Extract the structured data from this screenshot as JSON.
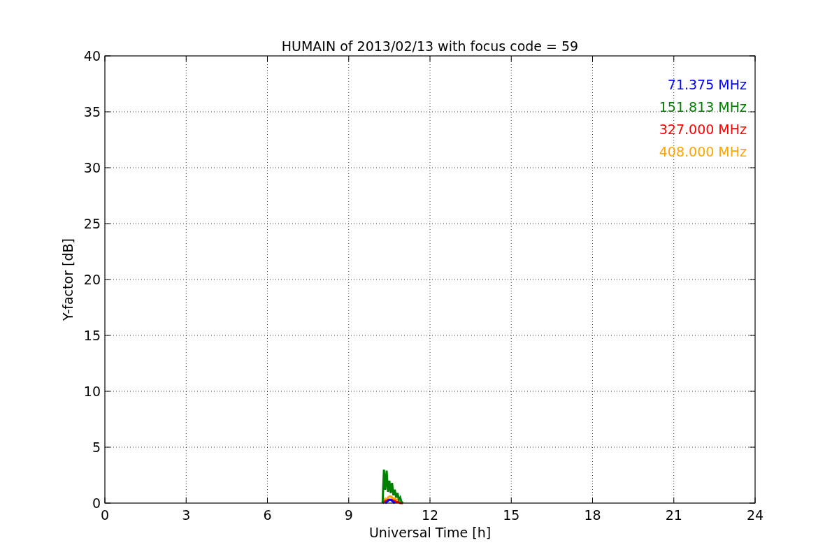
{
  "chart_data": {
    "type": "line",
    "title": "HUMAIN of 2013/02/13 with focus code = 59",
    "xlabel": "Universal Time [h]",
    "ylabel": "Y-factor [dB]",
    "x": [
      10.25,
      10.3,
      10.35,
      10.4,
      10.45,
      10.5,
      10.55,
      10.6,
      10.65,
      10.7,
      10.75,
      10.8,
      10.85,
      10.9,
      10.95,
      11.0
    ],
    "series": [
      {
        "name": "71.375 MHz",
        "color": "#0000ff",
        "values": [
          null,
          null,
          0,
          0.1,
          0.2,
          0.3,
          0.3,
          0.2,
          0.1,
          0,
          null,
          null,
          null,
          null,
          null,
          null
        ]
      },
      {
        "name": "151.813 MHz",
        "color": "#008000",
        "values": [
          0,
          3,
          1.2,
          2.9,
          1.0,
          2.0,
          0.9,
          1.8,
          0.7,
          1.2,
          0.5,
          0.9,
          0.3,
          0.5,
          0.1,
          0
        ]
      },
      {
        "name": "327.000 MHz",
        "color": "#ff0000",
        "values": [
          0,
          0.1,
          0.2,
          0.2,
          0.3,
          0.3,
          0.3,
          0.3,
          0.2,
          0.2,
          0.1,
          0.1,
          0.1,
          0,
          0,
          0
        ]
      },
      {
        "name": "408.000 MHz",
        "color": "#ffa500",
        "values": [
          0,
          0.3,
          0.4,
          0.3,
          0.5,
          0.6,
          0.6,
          0.5,
          0.4,
          0.4,
          0.3,
          0.3,
          0.2,
          0.2,
          0.1,
          0
        ]
      }
    ],
    "xlim": [
      0,
      24
    ],
    "ylim": [
      0,
      40
    ],
    "xticks": [
      0,
      3,
      6,
      9,
      12,
      15,
      18,
      21,
      24
    ],
    "yticks": [
      0,
      5,
      10,
      15,
      20,
      25,
      30,
      35,
      40
    ],
    "grid": true
  }
}
